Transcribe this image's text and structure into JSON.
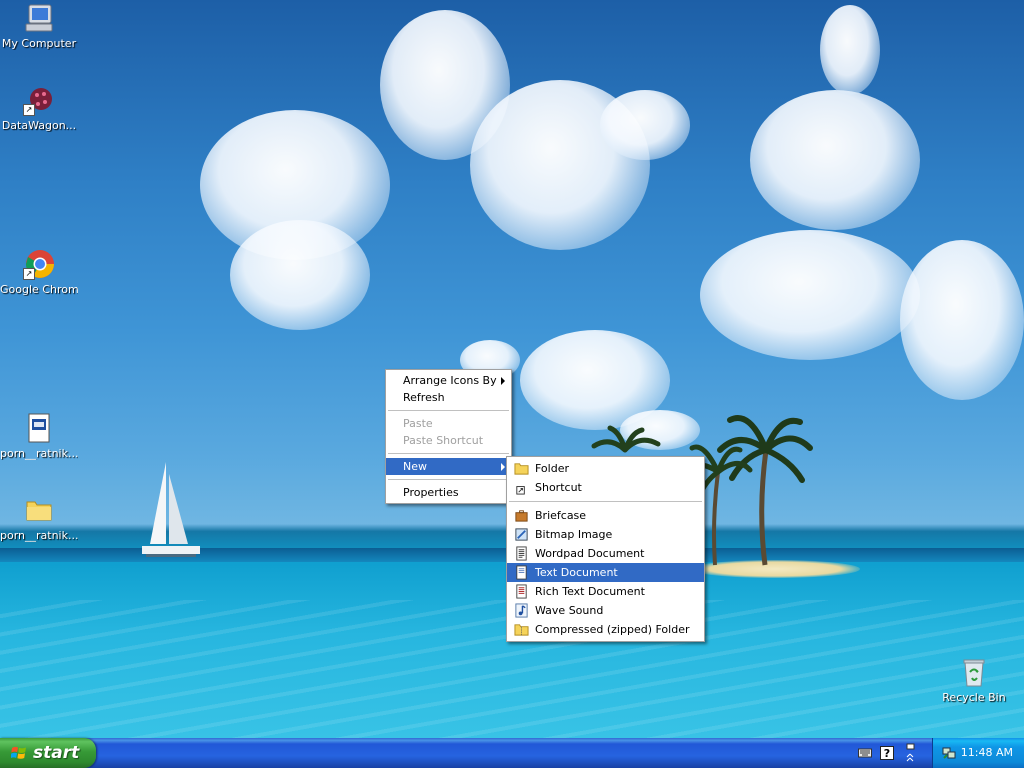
{
  "desktop": {
    "icons": [
      {
        "label": "My Computer",
        "icon": "my-computer-icon"
      },
      {
        "label": "DataWagon...",
        "icon": "datawagon-icon"
      },
      {
        "label": "Google Chrome",
        "icon": "chrome-icon"
      },
      {
        "label": "porn__ratnik...",
        "icon": "executable-file-icon"
      },
      {
        "label": "porn__ratnik...",
        "icon": "folder-icon"
      },
      {
        "label": "Recycle Bin",
        "icon": "recycle-bin-icon"
      }
    ]
  },
  "context_menu": {
    "items": [
      {
        "label": "Arrange Icons By",
        "has_submenu": true
      },
      {
        "label": "Refresh"
      },
      {
        "label": "Paste",
        "disabled": true
      },
      {
        "label": "Paste Shortcut",
        "disabled": true
      },
      {
        "label": "New",
        "has_submenu": true,
        "highlighted": true
      },
      {
        "label": "Properties"
      }
    ]
  },
  "new_submenu": {
    "items": [
      {
        "label": "Folder",
        "icon": "folder-icon"
      },
      {
        "label": "Shortcut",
        "icon": "shortcut-icon"
      },
      {
        "label": "Briefcase",
        "icon": "briefcase-icon"
      },
      {
        "label": "Bitmap Image",
        "icon": "bitmap-image-icon"
      },
      {
        "label": "Wordpad Document",
        "icon": "wordpad-document-icon"
      },
      {
        "label": "Text Document",
        "icon": "text-document-icon",
        "highlighted": true
      },
      {
        "label": "Rich Text Document",
        "icon": "rich-text-document-icon"
      },
      {
        "label": "Wave Sound",
        "icon": "wave-sound-icon"
      },
      {
        "label": "Compressed (zipped) Folder",
        "icon": "zipped-folder-icon"
      }
    ]
  },
  "taskbar": {
    "start_label": "start",
    "clock": "11:48 AM",
    "tray_icons": [
      "keyboard-icon",
      "help-icon",
      "safely-remove-hardware-icon",
      "network-icon"
    ]
  },
  "colors": {
    "menu_highlight": "#316ac5",
    "taskbar_blue": "#2458d8",
    "start_green": "#3c9a3c",
    "tray_blue": "#0f96e6"
  }
}
